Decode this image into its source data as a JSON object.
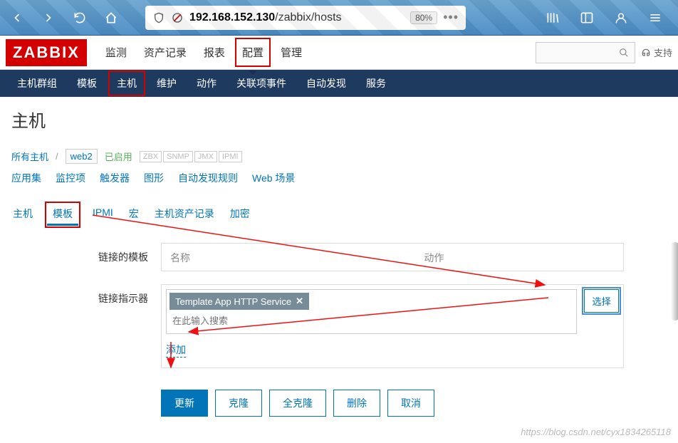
{
  "browser": {
    "url_prefix": "192.168.152.130",
    "url_path": "/zabbix/hosts",
    "zoom": "80%"
  },
  "header": {
    "logo": "ZABBIX",
    "menu": [
      "监测",
      "资产记录",
      "报表",
      "配置",
      "管理"
    ],
    "active_menu_index": 3,
    "support": "支持"
  },
  "subnav": {
    "items": [
      "主机群组",
      "模板",
      "主机",
      "维护",
      "动作",
      "关联项事件",
      "自动发现",
      "服务"
    ],
    "active_index": 2
  },
  "page": {
    "title": "主机",
    "breadcrumb_all": "所有主机",
    "breadcrumb_host": "web2",
    "status": "已启用",
    "protocols": [
      "ZBX",
      "SNMP",
      "JMX",
      "IPMI"
    ],
    "links": [
      "应用集",
      "监控项",
      "触发器",
      "图形",
      "自动发现规则",
      "Web 场景"
    ],
    "tabs": [
      "主机",
      "模板",
      "IPMI",
      "宏",
      "主机资产记录",
      "加密"
    ],
    "active_tab_index": 1
  },
  "form": {
    "linked_templates_label": "链接的模板",
    "col_name": "名称",
    "col_action": "动作",
    "link_indicator_label": "链接指示器",
    "template_tag": "Template App HTTP Service",
    "search_placeholder": "在此输入搜索",
    "select_btn": "选择",
    "add_link": "添加"
  },
  "buttons": {
    "update": "更新",
    "clone": "克隆",
    "full_clone": "全克隆",
    "delete": "删除",
    "cancel": "取消"
  },
  "watermark": "https://blog.csdn.net/cyx1834265118"
}
